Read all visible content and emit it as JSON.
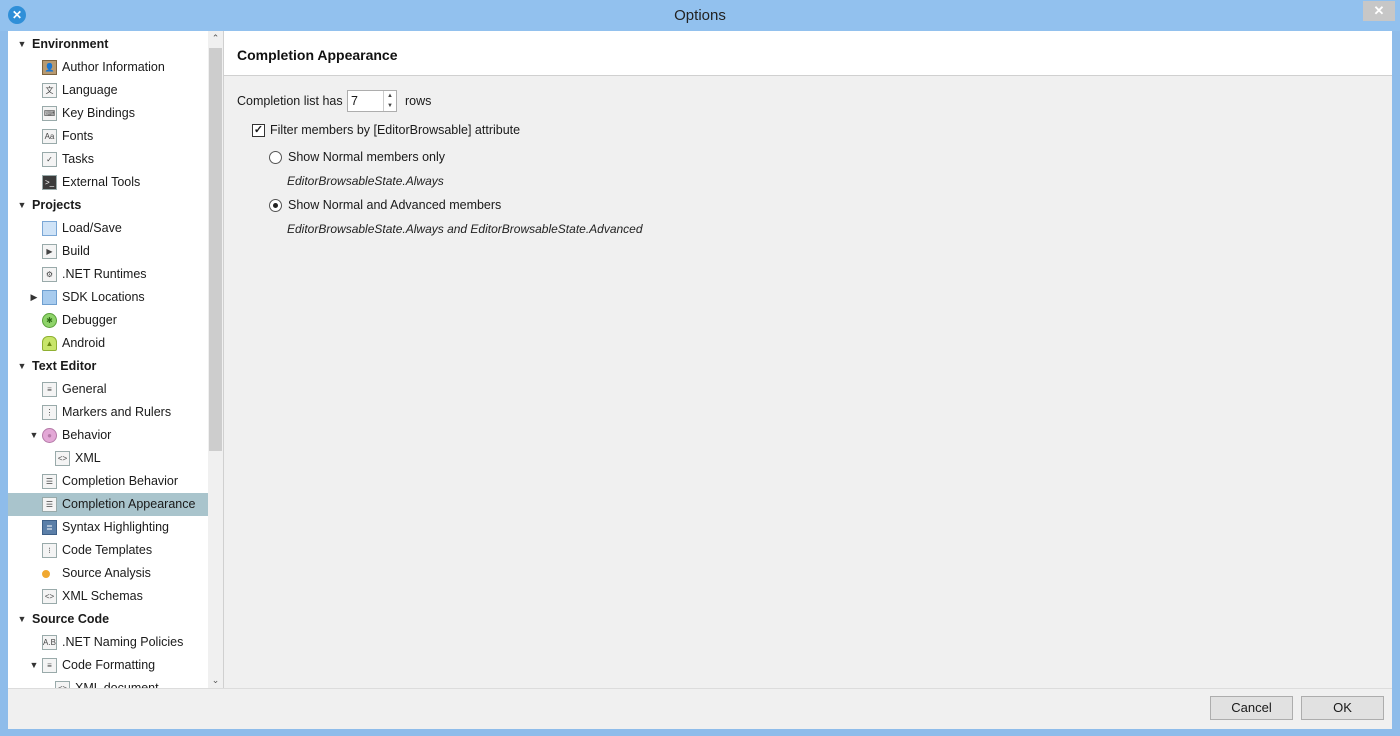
{
  "window": {
    "title": "Options",
    "close_glyph": "✕"
  },
  "sidebar": {
    "items": [
      {
        "label": "Environment",
        "level": 0,
        "category": true,
        "expander": "down",
        "icon": ""
      },
      {
        "label": "Author Information",
        "level": 1,
        "icon": "author-icon"
      },
      {
        "label": "Language",
        "level": 1,
        "icon": "language-icon"
      },
      {
        "label": "Key Bindings",
        "level": 1,
        "icon": "key-bindings-icon"
      },
      {
        "label": "Fonts",
        "level": 1,
        "icon": "fonts-icon"
      },
      {
        "label": "Tasks",
        "level": 1,
        "icon": "tasks-icon"
      },
      {
        "label": "External Tools",
        "level": 1,
        "icon": "terminal-icon"
      },
      {
        "label": "Projects",
        "level": 0,
        "category": true,
        "expander": "down",
        "icon": ""
      },
      {
        "label": "Load/Save",
        "level": 1,
        "icon": "load-save-icon"
      },
      {
        "label": "Build",
        "level": 1,
        "icon": "build-icon"
      },
      {
        "label": ".NET Runtimes",
        "level": 1,
        "icon": "gear-icon"
      },
      {
        "label": "SDK Locations",
        "level": 1,
        "expander": "right",
        "icon": "folder-icon"
      },
      {
        "label": "Debugger",
        "level": 1,
        "icon": "bug-icon"
      },
      {
        "label": "Android",
        "level": 1,
        "icon": "android-icon"
      },
      {
        "label": "Text Editor",
        "level": 0,
        "category": true,
        "expander": "down",
        "icon": ""
      },
      {
        "label": "General",
        "level": 1,
        "icon": "text-settings-icon"
      },
      {
        "label": "Markers and Rulers",
        "level": 1,
        "icon": "markers-icon"
      },
      {
        "label": "Behavior",
        "level": 1,
        "expander": "down",
        "icon": "brain-icon"
      },
      {
        "label": "XML",
        "level": 2,
        "icon": "xml-icon"
      },
      {
        "label": "Completion Behavior",
        "level": 1,
        "icon": "list-icon"
      },
      {
        "label": "Completion Appearance",
        "level": 1,
        "selected": true,
        "icon": "list-icon"
      },
      {
        "label": "Syntax Highlighting",
        "level": 1,
        "icon": "syntax-icon"
      },
      {
        "label": "Code Templates",
        "level": 1,
        "icon": "template-icon"
      },
      {
        "label": "Source Analysis",
        "level": 1,
        "icon": "dot-icon"
      },
      {
        "label": "XML Schemas",
        "level": 1,
        "icon": "xml-icon"
      },
      {
        "label": "Source Code",
        "level": 0,
        "category": true,
        "expander": "down",
        "icon": ""
      },
      {
        "label": ".NET Naming Policies",
        "level": 1,
        "icon": "naming-icon"
      },
      {
        "label": "Code Formatting",
        "level": 1,
        "expander": "down",
        "icon": "format-icon"
      },
      {
        "label": "XML document",
        "level": 2,
        "icon": "xml-icon"
      }
    ],
    "scroll_up": "⌃",
    "scroll_down": "⌄"
  },
  "panel": {
    "title": "Completion Appearance",
    "rows_prefix": "Completion list has",
    "rows_value": "7",
    "rows_suffix": "rows",
    "spin_up": "▲",
    "spin_down": "▼",
    "filter_label": "Filter members by [EditorBrowsable] attribute",
    "filter_checked": true,
    "check_glyph": "✓",
    "option_normal": "Show Normal members only",
    "option_normal_hint": "EditorBrowsableState.Always",
    "option_advanced": "Show Normal and Advanced members",
    "option_advanced_hint": "EditorBrowsableState.Always and EditorBrowsableState.Advanced",
    "selected_option": "advanced"
  },
  "footer": {
    "cancel": "Cancel",
    "ok": "OK"
  },
  "colors": {
    "title_bar": "#92c1ee",
    "selection": "#a9c4cc",
    "app_icon": "#2f8fd8"
  }
}
